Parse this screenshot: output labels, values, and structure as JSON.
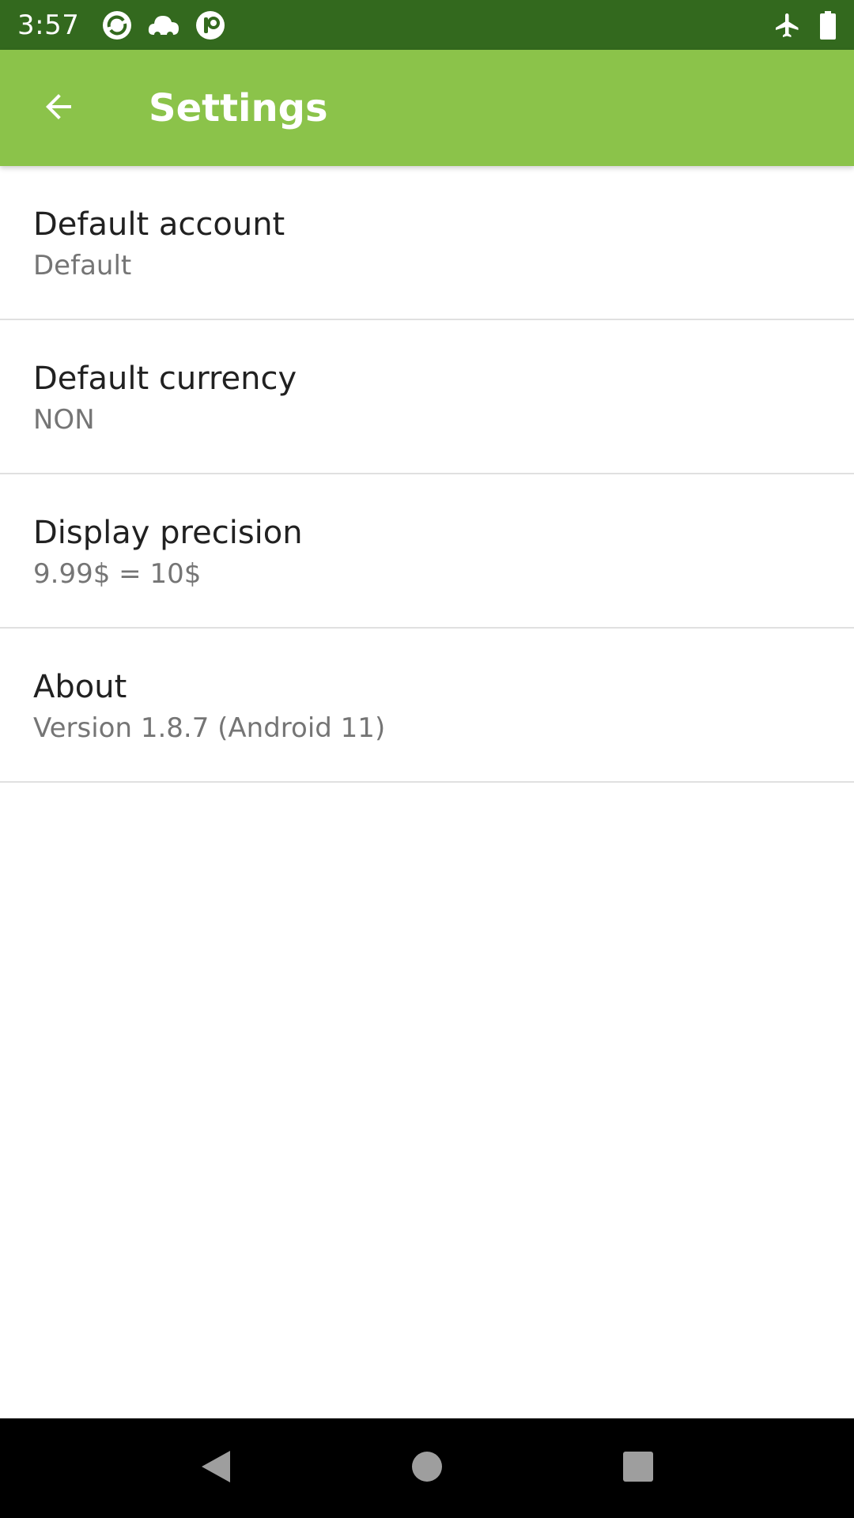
{
  "status_bar": {
    "time": "3:57",
    "left_icons": [
      "sync-icon",
      "cloud-icon",
      "app-notification-icon"
    ],
    "right_icons": [
      "airplane-mode-icon",
      "battery-icon"
    ]
  },
  "app_bar": {
    "title": "Settings",
    "back_icon": "arrow-back-icon"
  },
  "settings": [
    {
      "title": "Default account",
      "summary": "Default"
    },
    {
      "title": "Default currency",
      "summary": "NON"
    },
    {
      "title": "Display precision",
      "summary": "9.99$ = 10$"
    },
    {
      "title": "About",
      "summary": "Version 1.8.7 (Android 11)"
    }
  ],
  "nav_bar": {
    "buttons": [
      "back-triangle-icon",
      "home-circle-icon",
      "recents-square-icon"
    ]
  },
  "colors": {
    "status_bar": "#33691e",
    "app_bar": "#8bc34a",
    "title_text": "#212121",
    "summary_text": "#757575",
    "divider": "#e0e0e0"
  }
}
